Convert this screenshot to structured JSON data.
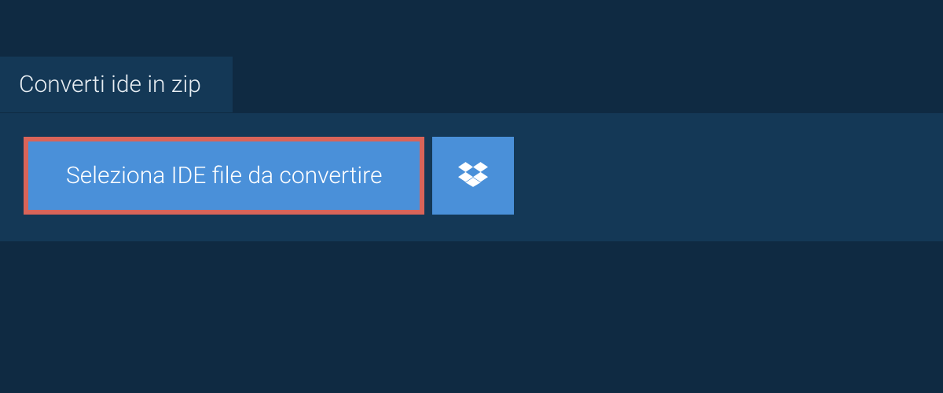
{
  "tab": {
    "label": "Converti ide in zip"
  },
  "actions": {
    "select_file_label": "Seleziona IDE file da convertire"
  },
  "colors": {
    "background": "#0f2a42",
    "panel": "#143856",
    "button": "#4a90d9",
    "highlight_border": "#d96459"
  }
}
